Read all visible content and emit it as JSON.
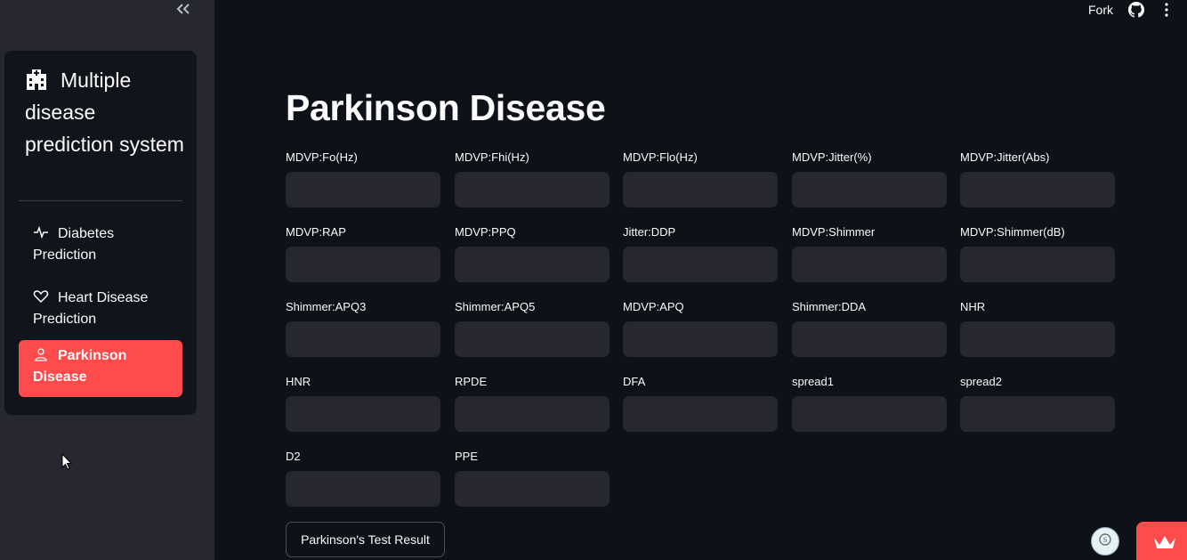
{
  "sidebar": {
    "collapse_icon": "double-chevron-left-icon",
    "menu_title": "Multiple disease prediction system",
    "menu_title_icon": "hospital-icon",
    "items": [
      {
        "label": "Diabetes Prediction",
        "icon": "activity-icon",
        "active": false
      },
      {
        "label": "Heart Disease Prediction",
        "icon": "heart-icon",
        "active": false
      },
      {
        "label": "Parkinson Disease",
        "icon": "person-icon",
        "active": true
      }
    ]
  },
  "toolbar": {
    "fork_label": "Fork",
    "github_icon": "github-icon",
    "menu_icon": "kebab-menu-icon"
  },
  "main": {
    "title": "Parkinson Disease",
    "fields": [
      {
        "label": "MDVP:Fo(Hz)",
        "value": ""
      },
      {
        "label": "MDVP:Fhi(Hz)",
        "value": ""
      },
      {
        "label": "MDVP:Flo(Hz)",
        "value": ""
      },
      {
        "label": "MDVP:Jitter(%)",
        "value": ""
      },
      {
        "label": "MDVP:Jitter(Abs)",
        "value": ""
      },
      {
        "label": "MDVP:RAP",
        "value": ""
      },
      {
        "label": "MDVP:PPQ",
        "value": ""
      },
      {
        "label": "Jitter:DDP",
        "value": ""
      },
      {
        "label": "MDVP:Shimmer",
        "value": ""
      },
      {
        "label": "MDVP:Shimmer(dB)",
        "value": ""
      },
      {
        "label": "Shimmer:APQ3",
        "value": ""
      },
      {
        "label": "Shimmer:APQ5",
        "value": ""
      },
      {
        "label": "MDVP:APQ",
        "value": ""
      },
      {
        "label": "Shimmer:DDA",
        "value": ""
      },
      {
        "label": "NHR",
        "value": ""
      },
      {
        "label": "HNR",
        "value": ""
      },
      {
        "label": "RPDE",
        "value": ""
      },
      {
        "label": "DFA",
        "value": ""
      },
      {
        "label": "spread1",
        "value": ""
      },
      {
        "label": "spread2",
        "value": ""
      },
      {
        "label": "D2",
        "value": ""
      },
      {
        "label": "PPE",
        "value": ""
      }
    ],
    "submit_label": "Parkinson's Test Result"
  },
  "colors": {
    "accent": "#ff4b4b",
    "background": "#0e1117",
    "sidebar": "#262730",
    "input": "#262730"
  }
}
